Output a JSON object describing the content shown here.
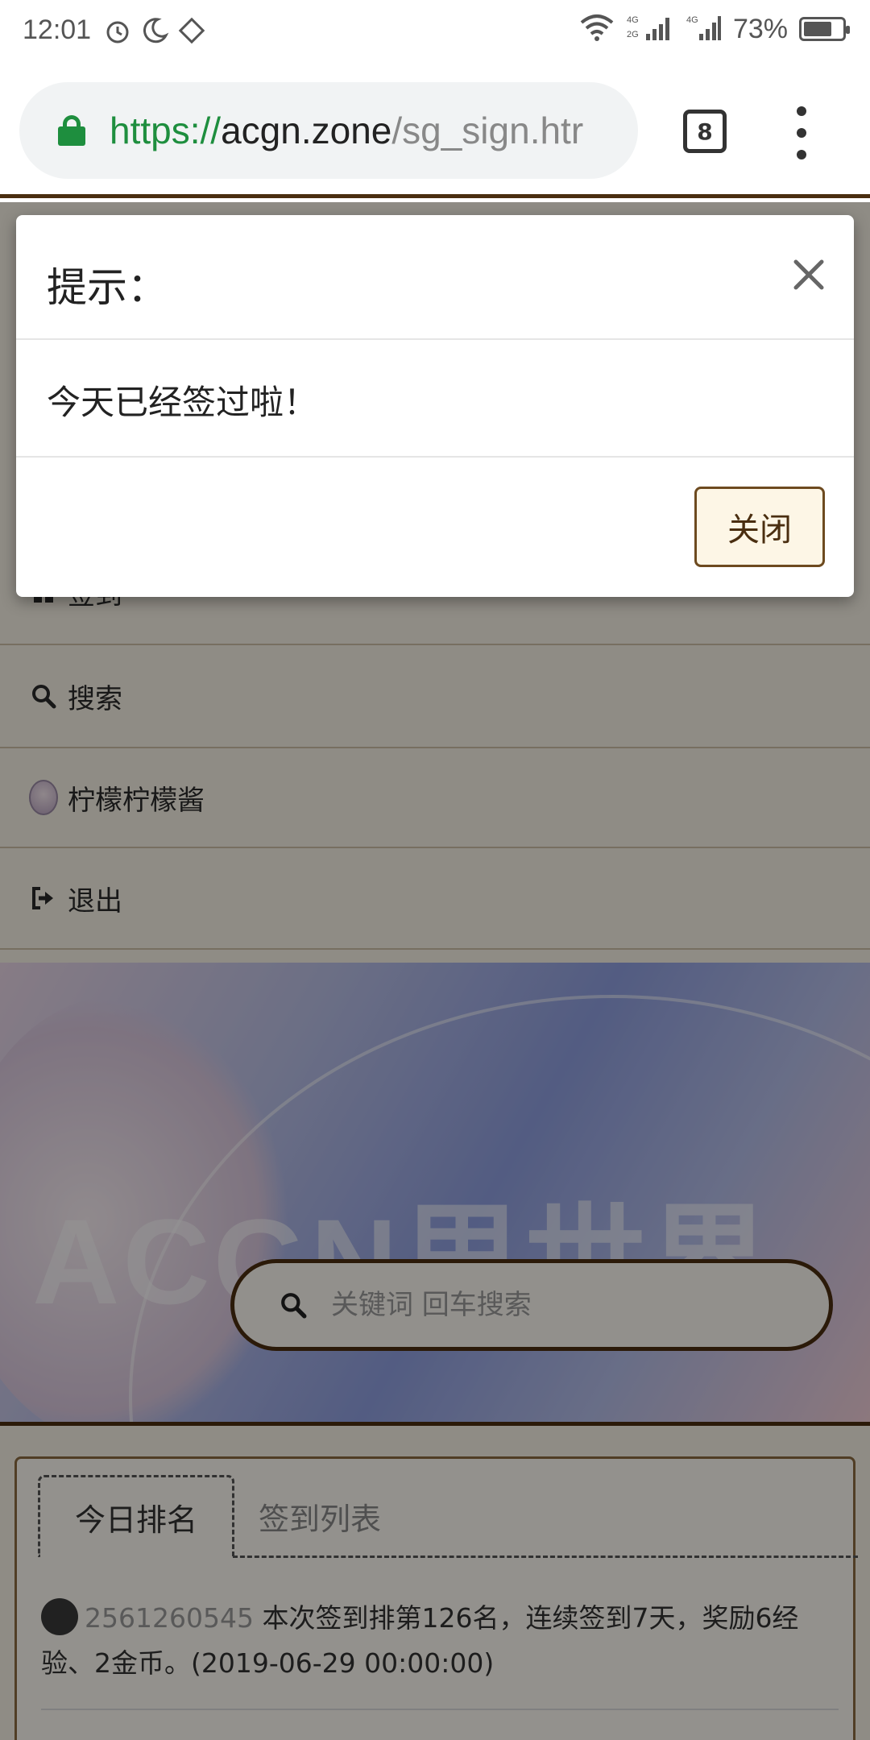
{
  "status_bar": {
    "time": "12:01",
    "icons": [
      "alarm-icon",
      "moon-icon",
      "rotate-icon"
    ],
    "network_labels": [
      "4G",
      "2G",
      "4G"
    ],
    "battery_percent": 73,
    "battery_text": "73%"
  },
  "browser": {
    "url_scheme": "https://",
    "url_host": "acgn.zone",
    "url_path": "/sg_sign.htr",
    "tab_count": "8"
  },
  "nav": {
    "items": [
      {
        "label": "签到",
        "icon": "gift-icon"
      },
      {
        "label": "搜索",
        "icon": "search-icon"
      },
      {
        "label": "柠檬柠檬酱",
        "icon": "avatar"
      },
      {
        "label": "退出",
        "icon": "logout-icon"
      }
    ]
  },
  "banner": {
    "logo_text": "ACGN里世界"
  },
  "search": {
    "placeholder": "关键词 回车搜索",
    "value": ""
  },
  "rank_panel": {
    "tabs": [
      "今日排名",
      "签到列表"
    ],
    "active_tab": "今日排名",
    "first_row": {
      "user_id": "2561260545",
      "text": " 本次签到排第126名，连续签到7天，奖励6经验、2金币。(2019-06-29 00:00:00)"
    }
  },
  "modal": {
    "title": "提示：",
    "message": "今天已经签过啦！",
    "close_button": "关闭"
  },
  "colors": {
    "accent_brown": "#4a2e10",
    "secure_green": "#1e8e3e",
    "button_bg": "#fdf6e6"
  }
}
